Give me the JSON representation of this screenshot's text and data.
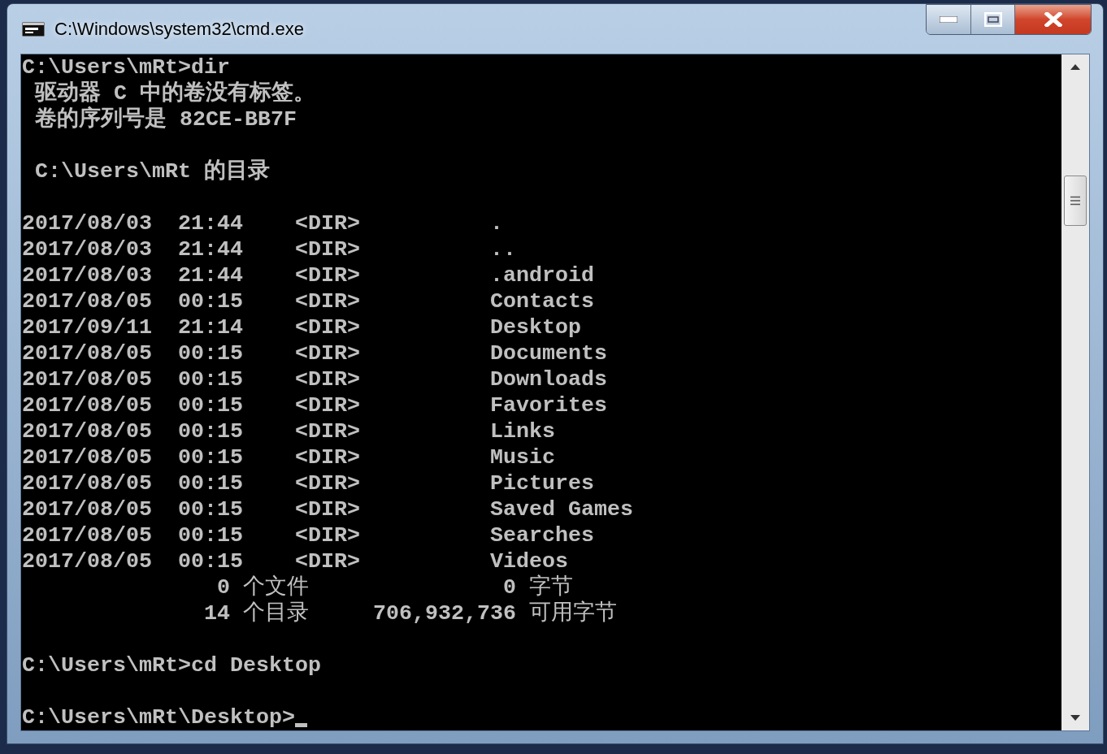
{
  "window": {
    "title": "C:\\Windows\\system32\\cmd.exe"
  },
  "console": [
    {
      "kind": "text",
      "text": "C:\\Users\\mRt>dir"
    },
    {
      "kind": "text",
      "text": " 驱动器 C 中的卷没有标签。"
    },
    {
      "kind": "text",
      "text": " 卷的序列号是 82CE-BB7F"
    },
    {
      "kind": "blank"
    },
    {
      "kind": "text",
      "text": " C:\\Users\\mRt 的目录"
    },
    {
      "kind": "blank"
    },
    {
      "kind": "entry",
      "date": "2017/08/03",
      "time": "21:44",
      "type": "<DIR>",
      "name": "."
    },
    {
      "kind": "entry",
      "date": "2017/08/03",
      "time": "21:44",
      "type": "<DIR>",
      "name": ".."
    },
    {
      "kind": "entry",
      "date": "2017/08/03",
      "time": "21:44",
      "type": "<DIR>",
      "name": ".android"
    },
    {
      "kind": "entry",
      "date": "2017/08/05",
      "time": "00:15",
      "type": "<DIR>",
      "name": "Contacts"
    },
    {
      "kind": "entry",
      "date": "2017/09/11",
      "time": "21:14",
      "type": "<DIR>",
      "name": "Desktop"
    },
    {
      "kind": "entry",
      "date": "2017/08/05",
      "time": "00:15",
      "type": "<DIR>",
      "name": "Documents"
    },
    {
      "kind": "entry",
      "date": "2017/08/05",
      "time": "00:15",
      "type": "<DIR>",
      "name": "Downloads"
    },
    {
      "kind": "entry",
      "date": "2017/08/05",
      "time": "00:15",
      "type": "<DIR>",
      "name": "Favorites"
    },
    {
      "kind": "entry",
      "date": "2017/08/05",
      "time": "00:15",
      "type": "<DIR>",
      "name": "Links"
    },
    {
      "kind": "entry",
      "date": "2017/08/05",
      "time": "00:15",
      "type": "<DIR>",
      "name": "Music"
    },
    {
      "kind": "entry",
      "date": "2017/08/05",
      "time": "00:15",
      "type": "<DIR>",
      "name": "Pictures"
    },
    {
      "kind": "entry",
      "date": "2017/08/05",
      "time": "00:15",
      "type": "<DIR>",
      "name": "Saved Games"
    },
    {
      "kind": "entry",
      "date": "2017/08/05",
      "time": "00:15",
      "type": "<DIR>",
      "name": "Searches"
    },
    {
      "kind": "entry",
      "date": "2017/08/05",
      "time": "00:15",
      "type": "<DIR>",
      "name": "Videos"
    },
    {
      "kind": "summary",
      "count": "0",
      "label": "个文件",
      "size": "0",
      "size_label": "字节"
    },
    {
      "kind": "summary",
      "count": "14",
      "label": "个目录",
      "size": "706,932,736",
      "size_label": "可用字节"
    },
    {
      "kind": "blank"
    },
    {
      "kind": "text",
      "text": "C:\\Users\\mRt>cd Desktop"
    },
    {
      "kind": "blank"
    },
    {
      "kind": "prompt",
      "text": "C:\\Users\\mRt\\Desktop>",
      "cursor": true
    }
  ]
}
